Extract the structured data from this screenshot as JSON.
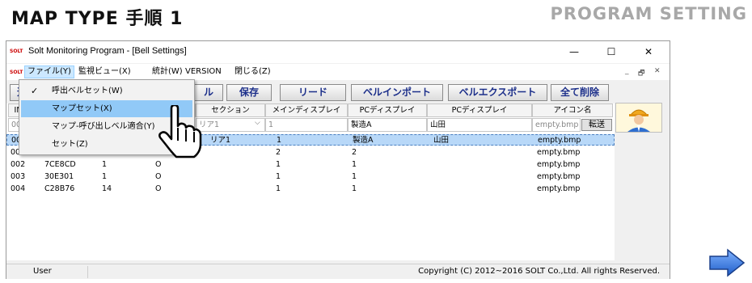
{
  "header": {
    "title": "MAP TYPE 手順 1",
    "subtitle": "PROGRAM SETTING"
  },
  "window": {
    "logo": "SOLT",
    "title": "Solt Monitoring Program - [Bell Settings]",
    "controls": {
      "minimize": "—",
      "maximize": "☐",
      "close": "✕"
    }
  },
  "menubar": {
    "logo": "SOLT",
    "items": [
      {
        "label": "ファイル(Y)"
      },
      {
        "label": "監視ビュー(X)"
      },
      {
        "label": "統計(W)"
      },
      {
        "label": "VERSION"
      },
      {
        "label": "閉じる(Z)"
      }
    ],
    "mdi_controls": {
      "minimize": "_",
      "restore": "🗗",
      "close": "✕"
    }
  },
  "dropdown": {
    "items": [
      {
        "label": "呼出ベルセット(W)",
        "checked": true
      },
      {
        "label": "マップセット(X)"
      },
      {
        "label": "マップ-呼び出しベル適合(Y)"
      },
      {
        "label": "セット(Z)"
      }
    ]
  },
  "toolbar": {
    "partial_left": "追",
    "partial_right": "ル",
    "save": "保存",
    "read": "リード",
    "bell_import": "ベルインポート",
    "bell_export": "ベルエクスポート",
    "delete_all": "全て削除"
  },
  "grid": {
    "headers": [
      "IN",
      "",
      "",
      "",
      "セクション",
      "メインディスプレイ",
      "PCディスプレイ",
      "PCディスプレイ",
      "アイコン名"
    ],
    "input_row": {
      "code": "000",
      "section": "リア1",
      "main_display": "1",
      "pc_display": "製造A",
      "pc_display2": "山田",
      "icon": "empty.bmp",
      "send": "転送"
    },
    "rows": [
      {
        "code": "000",
        "id": "",
        "num": "",
        "flag": "",
        "section": "リア1",
        "main": "1",
        "pc": "製造A",
        "pc2": "山田",
        "icon": "empty.bmp",
        "selected": true
      },
      {
        "code": "001",
        "id": "",
        "num": "",
        "flag": "",
        "section": "",
        "main": "2",
        "pc": "2",
        "pc2": "",
        "icon": "empty.bmp"
      },
      {
        "code": "002",
        "id": "7CE8CD",
        "num": "1",
        "flag": "O",
        "section": "",
        "main": "1",
        "pc": "1",
        "pc2": "",
        "icon": "empty.bmp"
      },
      {
        "code": "003",
        "id": "30E301",
        "num": "1",
        "flag": "O",
        "section": "",
        "main": "1",
        "pc": "1",
        "pc2": "",
        "icon": "empty.bmp"
      },
      {
        "code": "004",
        "id": "C28B76",
        "num": "14",
        "flag": "O",
        "section": "",
        "main": "1",
        "pc": "1",
        "pc2": "",
        "icon": "empty.bmp"
      }
    ]
  },
  "status": {
    "user": "User",
    "copyright": "Copyright (C) 2012~2016 SOLT Co.,Ltd. All rights Reserved."
  }
}
